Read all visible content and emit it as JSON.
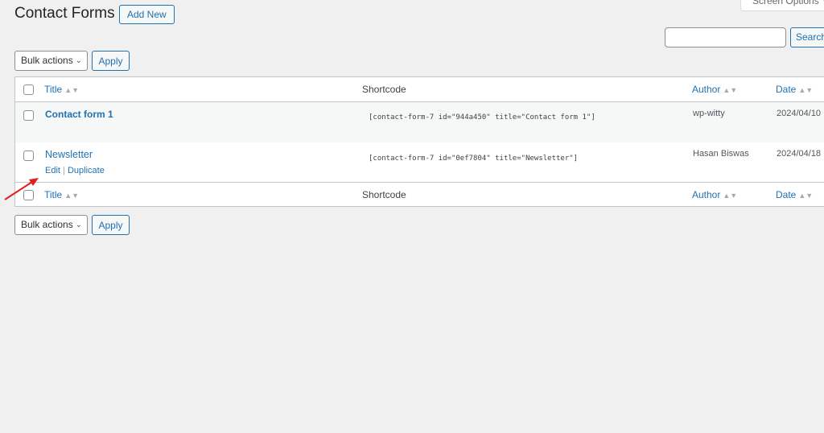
{
  "header": {
    "screen_options": "Screen Options",
    "title": "Contact Forms",
    "add_new": "Add New"
  },
  "search": {
    "value": "",
    "placeholder": "",
    "button": "Search"
  },
  "bulk_actions": {
    "top": {
      "select": "Bulk actions",
      "apply": "Apply"
    },
    "bottom": {
      "select": "Bulk actions",
      "apply": "Apply"
    }
  },
  "table": {
    "columns": {
      "title": "Title",
      "shortcode": "Shortcode",
      "author": "Author",
      "date": "Date"
    },
    "rows": [
      {
        "title": "Contact form 1",
        "shortcode": "[contact-form-7 id=\"944a450\" title=\"Contact form 1\"]",
        "author": "wp-witty",
        "date": "2024/04/10"
      },
      {
        "title": "Newsletter",
        "shortcode": "[contact-form-7 id=\"0ef7804\" title=\"Newsletter\"]",
        "author": "Hasan Biswas",
        "date": "2024/04/18",
        "row_actions": {
          "edit": "Edit",
          "separator": "|",
          "duplicate": "Duplicate"
        }
      }
    ]
  },
  "annotation": {
    "arrow_color": "#e02020",
    "points_to": "Edit"
  },
  "colors": {
    "link": "#2271b1",
    "background": "#f0f0f1"
  }
}
